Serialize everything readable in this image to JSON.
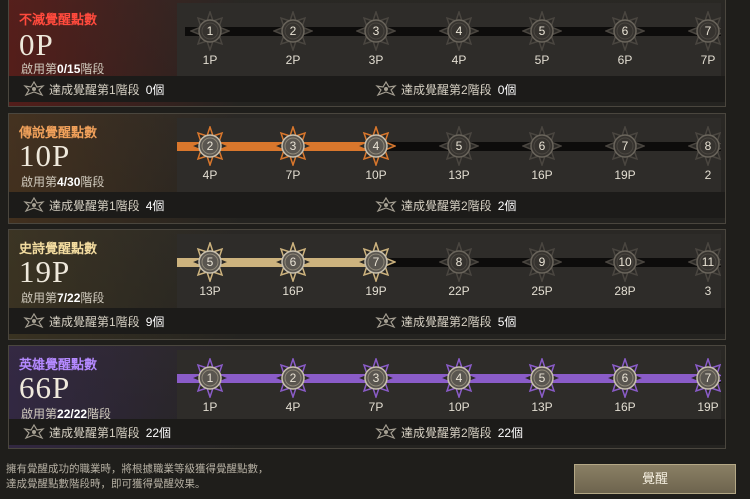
{
  "panels": [
    {
      "id": "immortal",
      "title": "不滅覺醒點數",
      "title_color": "#ff4a3d",
      "glow_color": "#7a1814",
      "points": "0P",
      "progress_prefix": "啟用第",
      "progress_value": "0/15",
      "progress_suffix": "階段",
      "fill_color": "#2e2c29",
      "filled_nodes": 0,
      "nodes": [
        {
          "num": "1",
          "cost": "1P"
        },
        {
          "num": "2",
          "cost": "2P"
        },
        {
          "num": "3",
          "cost": "3P"
        },
        {
          "num": "4",
          "cost": "4P"
        },
        {
          "num": "5",
          "cost": "5P"
        },
        {
          "num": "6",
          "cost": "6P"
        },
        {
          "num": "7",
          "cost": "7P"
        }
      ],
      "ach1_label": "達成覺醒第1階段",
      "ach1_count": "0個",
      "ach2_label": "達成覺醒第2階段",
      "ach2_count": "0個"
    },
    {
      "id": "legend",
      "title": "傳說覺醒點數",
      "title_color": "#f0a05a",
      "glow_color": "#5a3a1c",
      "points": "10P",
      "progress_prefix": "啟用第",
      "progress_value": "4/30",
      "progress_suffix": "階段",
      "fill_color": "#d9772c",
      "filled_nodes": 3,
      "nodes": [
        {
          "num": "2",
          "cost": "4P"
        },
        {
          "num": "3",
          "cost": "7P"
        },
        {
          "num": "4",
          "cost": "10P"
        },
        {
          "num": "5",
          "cost": "13P"
        },
        {
          "num": "6",
          "cost": "16P"
        },
        {
          "num": "7",
          "cost": "19P"
        },
        {
          "num": "8",
          "cost": "2"
        }
      ],
      "ach1_label": "達成覺醒第1階段",
      "ach1_count": "4個",
      "ach2_label": "達成覺醒第2階段",
      "ach2_count": "2個"
    },
    {
      "id": "epic",
      "title": "史詩覺醒點數",
      "title_color": "#f3dca0",
      "glow_color": "#4a3e22",
      "points": "19P",
      "progress_prefix": "啟用第",
      "progress_value": "7/22",
      "progress_suffix": "階段",
      "fill_color": "#cdb37e",
      "filled_nodes": 3,
      "nodes": [
        {
          "num": "5",
          "cost": "13P"
        },
        {
          "num": "6",
          "cost": "16P"
        },
        {
          "num": "7",
          "cost": "19P"
        },
        {
          "num": "8",
          "cost": "22P"
        },
        {
          "num": "9",
          "cost": "25P"
        },
        {
          "num": "10",
          "cost": "28P"
        },
        {
          "num": "11",
          "cost": "3"
        }
      ],
      "ach1_label": "達成覺醒第1階段",
      "ach1_count": "9個",
      "ach2_label": "達成覺醒第2階段",
      "ach2_count": "5個"
    },
    {
      "id": "hero",
      "title": "英雄覺醒點數",
      "title_color": "#b489ff",
      "glow_color": "#3c2a5c",
      "points": "66P",
      "progress_prefix": "啟用第",
      "progress_value": "22/22",
      "progress_suffix": "階段",
      "fill_color": "#8a5cc8",
      "filled_nodes": 7,
      "nodes": [
        {
          "num": "1",
          "cost": "1P"
        },
        {
          "num": "2",
          "cost": "4P"
        },
        {
          "num": "3",
          "cost": "7P"
        },
        {
          "num": "4",
          "cost": "10P"
        },
        {
          "num": "5",
          "cost": "13P"
        },
        {
          "num": "6",
          "cost": "16P"
        },
        {
          "num": "7",
          "cost": "19P"
        }
      ],
      "ach1_label": "達成覺醒第1階段",
      "ach1_count": "22個",
      "ach2_label": "達成覺醒第2階段",
      "ach2_count": "22個"
    }
  ],
  "achievement_icon": "awakening-crest-icon",
  "node_icon": "star-emblem-icon",
  "footer_note_line1": "擁有覺醒成功的職業時，將根據職業等級獲得覺醒點數，",
  "footer_note_line2": "達成覺醒點數階段時，即可獲得覺醒效果。",
  "awaken_button_label": "覺醒"
}
